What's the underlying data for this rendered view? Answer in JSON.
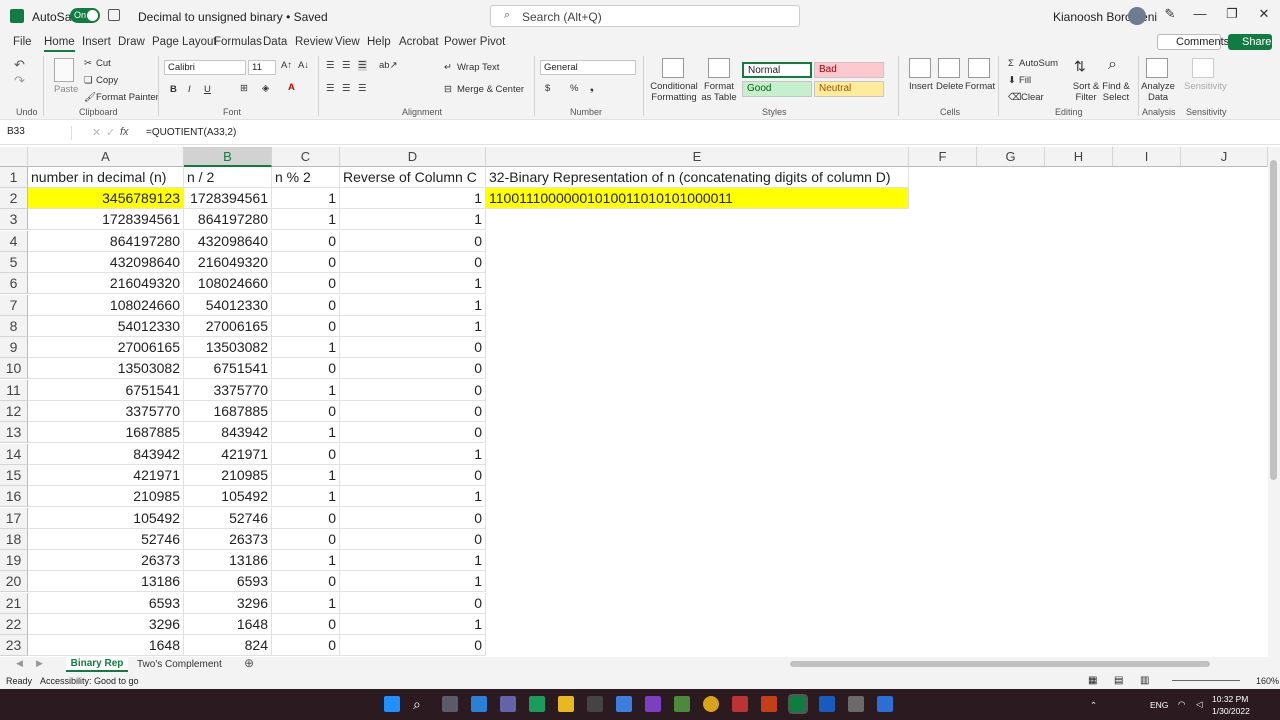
{
  "titlebar": {
    "autosave_label": "AutoSave",
    "autosave_state": "On",
    "document": "Decimal to unsigned binary • Saved",
    "search_placeholder": "Search (Alt+Q)",
    "user": "Kianoosh Boroojeni"
  },
  "menu": [
    "File",
    "Home",
    "Insert",
    "Draw",
    "Page Layout",
    "Formulas",
    "Data",
    "Review",
    "View",
    "Help",
    "Acrobat",
    "Power Pivot"
  ],
  "comments_label": "Comments",
  "share_label": "Share",
  "ribbon": {
    "undo_group": "Undo",
    "clipboard": {
      "paste": "Paste",
      "cut": "Cut",
      "copy": "Copy",
      "format_painter": "Format Painter",
      "group": "Clipboard"
    },
    "font": {
      "name": "Calibri",
      "size": "11",
      "group": "Font"
    },
    "alignment": {
      "wrap": "Wrap Text",
      "merge": "Merge & Center",
      "group": "Alignment"
    },
    "number": {
      "format": "General",
      "group": "Number"
    },
    "styles": {
      "conditional": "Conditional Formatting",
      "format_table": "Format as Table",
      "normal": "Normal",
      "bad": "Bad",
      "good": "Good",
      "neutral": "Neutral",
      "group": "Styles"
    },
    "cells": {
      "insert": "Insert",
      "delete": "Delete",
      "format": "Format",
      "group": "Cells"
    },
    "editing": {
      "autosum": "AutoSum",
      "fill": "Fill",
      "clear": "Clear",
      "sort": "Sort & Filter",
      "find": "Find & Select",
      "group": "Editing"
    },
    "analysis": {
      "analyze": "Analyze Data",
      "group": "Analysis"
    },
    "sensitivity": {
      "label": "Sensitivity",
      "group": "Sensitivity"
    }
  },
  "formula_bar": {
    "name_box": "B33",
    "formula": "=QUOTIENT(A33,2)"
  },
  "columns": [
    "A",
    "B",
    "C",
    "D",
    "E",
    "F",
    "G",
    "H",
    "I",
    "J"
  ],
  "headers": {
    "a": "number in decimal (n)",
    "b": "n / 2",
    "c": "n % 2",
    "d": "Reverse of Column C",
    "e": "32-Binary Representation of n (concatenating digits of column D)"
  },
  "binary_result": "11001110000001010011010101000011",
  "rows": [
    {
      "n": "2",
      "a": "3456789123",
      "b": "1728394561",
      "c": "1",
      "d": "1"
    },
    {
      "n": "3",
      "a": "1728394561",
      "b": "864197280",
      "c": "1",
      "d": "1"
    },
    {
      "n": "4",
      "a": "864197280",
      "b": "432098640",
      "c": "0",
      "d": "0"
    },
    {
      "n": "5",
      "a": "432098640",
      "b": "216049320",
      "c": "0",
      "d": "0"
    },
    {
      "n": "6",
      "a": "216049320",
      "b": "108024660",
      "c": "0",
      "d": "1"
    },
    {
      "n": "7",
      "a": "108024660",
      "b": "54012330",
      "c": "0",
      "d": "1"
    },
    {
      "n": "8",
      "a": "54012330",
      "b": "27006165",
      "c": "0",
      "d": "1"
    },
    {
      "n": "9",
      "a": "27006165",
      "b": "13503082",
      "c": "1",
      "d": "0"
    },
    {
      "n": "10",
      "a": "13503082",
      "b": "6751541",
      "c": "0",
      "d": "0"
    },
    {
      "n": "11",
      "a": "6751541",
      "b": "3375770",
      "c": "1",
      "d": "0"
    },
    {
      "n": "12",
      "a": "3375770",
      "b": "1687885",
      "c": "0",
      "d": "0"
    },
    {
      "n": "13",
      "a": "1687885",
      "b": "843942",
      "c": "1",
      "d": "0"
    },
    {
      "n": "14",
      "a": "843942",
      "b": "421971",
      "c": "0",
      "d": "1"
    },
    {
      "n": "15",
      "a": "421971",
      "b": "210985",
      "c": "1",
      "d": "0"
    },
    {
      "n": "16",
      "a": "210985",
      "b": "105492",
      "c": "1",
      "d": "1"
    },
    {
      "n": "17",
      "a": "105492",
      "b": "52746",
      "c": "0",
      "d": "0"
    },
    {
      "n": "18",
      "a": "52746",
      "b": "26373",
      "c": "0",
      "d": "0"
    },
    {
      "n": "19",
      "a": "26373",
      "b": "13186",
      "c": "1",
      "d": "1"
    },
    {
      "n": "20",
      "a": "13186",
      "b": "6593",
      "c": "0",
      "d": "1"
    },
    {
      "n": "21",
      "a": "6593",
      "b": "3296",
      "c": "1",
      "d": "0"
    },
    {
      "n": "22",
      "a": "3296",
      "b": "1648",
      "c": "0",
      "d": "1"
    },
    {
      "n": "23",
      "a": "1648",
      "b": "824",
      "c": "0",
      "d": "0"
    }
  ],
  "sheets": [
    "Binary Rep",
    "Two's Complement"
  ],
  "status": {
    "ready": "Ready",
    "accessibility": "Accessibility: Good to go",
    "zoom": "160%"
  },
  "taskbar": {
    "lang": "ENG",
    "time": "10:32 PM",
    "date": "1/30/2022"
  }
}
